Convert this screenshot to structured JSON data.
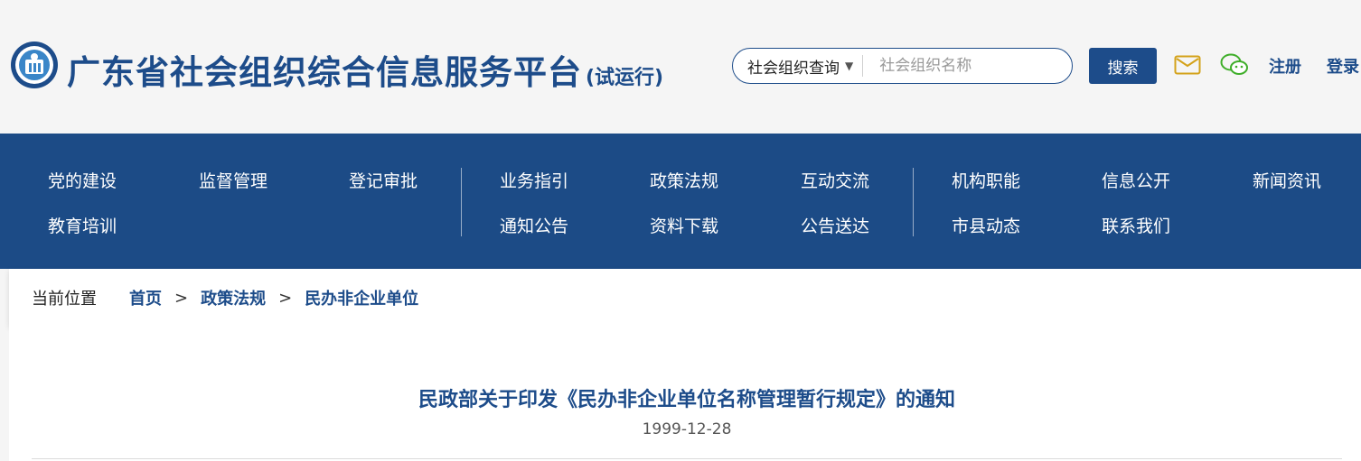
{
  "header": {
    "title": "广东省社会组织综合信息服务平台",
    "title_suffix": "(试运行)",
    "logo_icon": "emblem-icon",
    "search": {
      "select_value": "社会组织查询",
      "placeholder": "社会组织名称",
      "button_label": "搜索"
    },
    "icons": {
      "mail": "mail-icon",
      "wechat": "wechat-icon"
    },
    "register_label": "注册",
    "login_label": "登录",
    "colors": {
      "brand": "#1d4c8a",
      "mail": "#d4a21a",
      "wechat": "#3fae2a"
    }
  },
  "nav": {
    "row1": [
      "党的建设",
      "监督管理",
      "登记审批",
      "业务指引",
      "政策法规",
      "互动交流",
      "机构职能",
      "信息公开",
      "新闻资讯"
    ],
    "row2": [
      "教育培训",
      "通知公告",
      "资料下载",
      "公告送达",
      "市县动态",
      "联系我们"
    ],
    "background": "#1c4b86"
  },
  "breadcrumb": {
    "label": "当前位置",
    "items": [
      "首页",
      "政策法规",
      "民办非企业单位"
    ],
    "separator": ">"
  },
  "article": {
    "title": "民政部关于印发《民办非企业单位名称管理暂行规定》的通知",
    "date": "1999-12-28"
  }
}
